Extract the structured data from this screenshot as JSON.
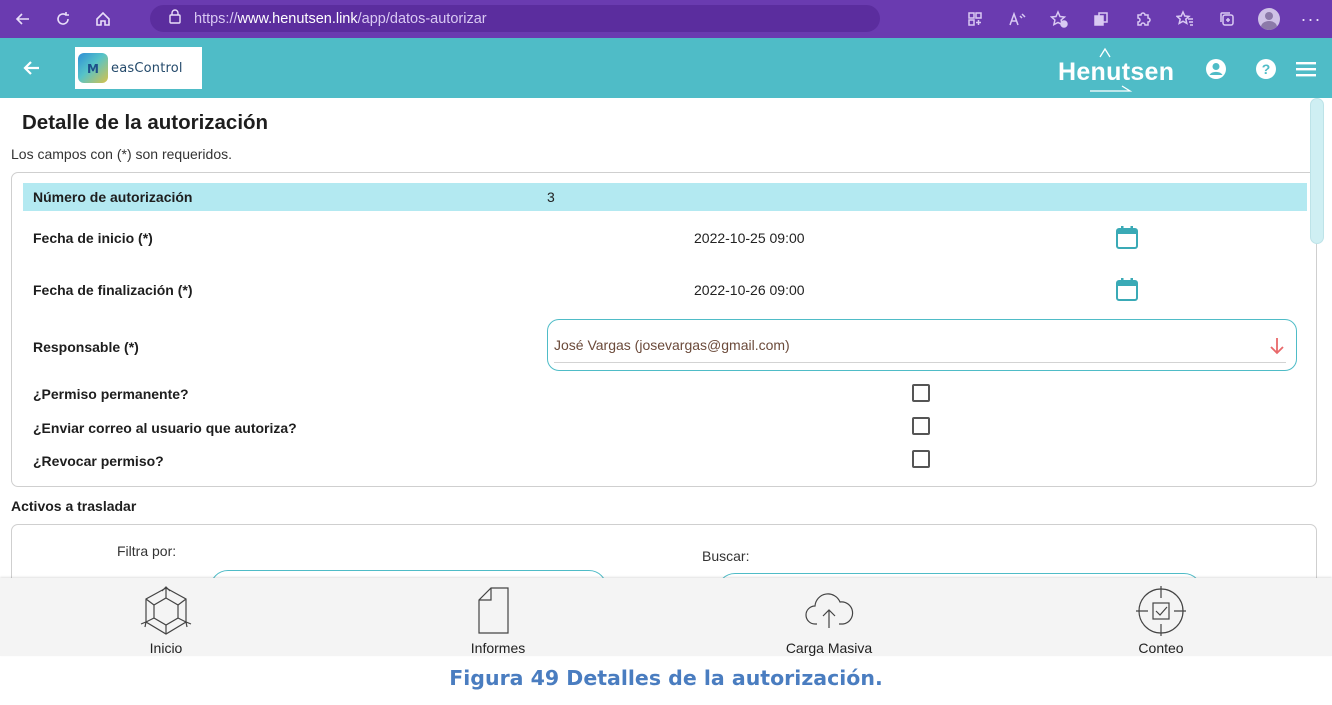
{
  "browser": {
    "url_protocol": "https://",
    "url_host": "www.henutsen.link",
    "url_path": "/app/datos-autorizar"
  },
  "header": {
    "logo_text": "easControl",
    "brand": "Henutsen",
    "accent_color": "#4fbcc7"
  },
  "page": {
    "title": "Detalle de la autorización",
    "required_note": "Los campos con (*) son requeridos."
  },
  "form": {
    "auth_number_label": "Número de autorización",
    "auth_number_value": "3",
    "start_label": "Fecha de inicio (*)",
    "start_value": "2022-10-25 09:00",
    "end_label": "Fecha de finalización (*)",
    "end_value": "2022-10-26 09:00",
    "responsible_label": "Responsable (*)",
    "responsible_value": "José Vargas (josevargas@gmail.com)",
    "permanent_label": "¿Permiso permanente?",
    "email_label": "¿Enviar correo al usuario que autoriza?",
    "revoke_label": "¿Revocar permiso?"
  },
  "assets": {
    "section_title": "Activos a trasladar",
    "filter_label": "Filtra por:",
    "search_label": "Buscar:"
  },
  "bottom_nav": {
    "items": [
      {
        "label": "Inicio",
        "icon": "cube-icon"
      },
      {
        "label": "Informes",
        "icon": "document-icon"
      },
      {
        "label": "Carga Masiva",
        "icon": "cloud-upload-icon"
      },
      {
        "label": "Conteo",
        "icon": "target-icon"
      }
    ]
  },
  "caption": "Figura 49 Detalles de la autorización."
}
